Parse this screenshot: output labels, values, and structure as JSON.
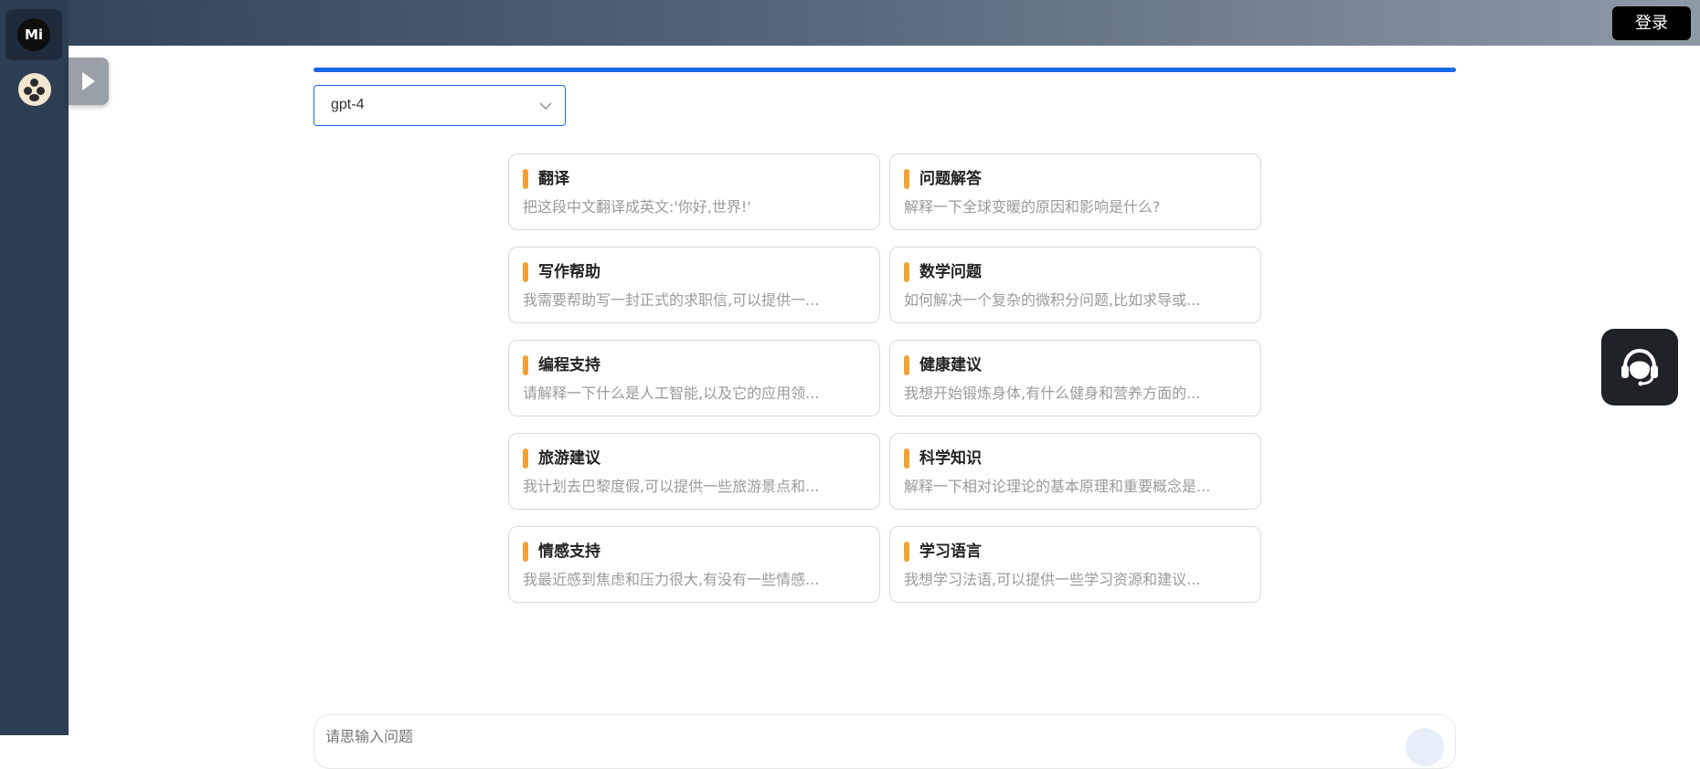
{
  "sidebar": {
    "logo_text": "Mi",
    "logo_icon": "mi-logo-icon",
    "avatar_icon": "user-avatar-icon"
  },
  "header": {
    "login_label": "登录"
  },
  "toggle": {
    "icon": "chevron-right-icon"
  },
  "progress": {
    "value": 1.0,
    "color": "#1868e6"
  },
  "model_select": {
    "value": "gpt-4",
    "icon": "chevron-down-icon"
  },
  "cards": [
    {
      "title": "翻译",
      "desc": "把这段中文翻译成英文:'你好,世界!'"
    },
    {
      "title": "问题解答",
      "desc": "解释一下全球变暖的原因和影响是什么?"
    },
    {
      "title": "写作帮助",
      "desc": "我需要帮助写一封正式的求职信,可以提供一..."
    },
    {
      "title": "数学问题",
      "desc": "如何解决一个复杂的微积分问题,比如求导或..."
    },
    {
      "title": "编程支持",
      "desc": "请解释一下什么是人工智能,以及它的应用领..."
    },
    {
      "title": "健康建议",
      "desc": "我想开始锻炼身体,有什么健身和营养方面的..."
    },
    {
      "title": "旅游建议",
      "desc": "我计划去巴黎度假,可以提供一些旅游景点和..."
    },
    {
      "title": "科学知识",
      "desc": "解释一下相对论理论的基本原理和重要概念是..."
    },
    {
      "title": "情感支持",
      "desc": "我最近感到焦虑和压力很大,有没有一些情感..."
    },
    {
      "title": "学习语言",
      "desc": "我想学习法语,可以提供一些学习资源和建议..."
    }
  ],
  "support": {
    "icon": "customer-service-headset-icon"
  },
  "input": {
    "placeholder": "请思输入问题"
  },
  "colors": {
    "accent": "#1868e6",
    "card_bar": "#f2a233",
    "sidebar": "#2e3e52"
  }
}
